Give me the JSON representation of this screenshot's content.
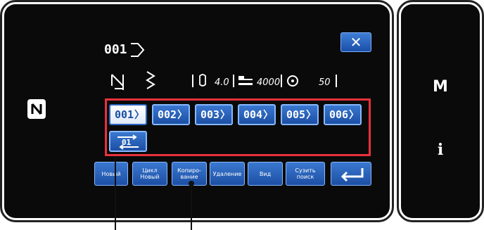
{
  "header": {
    "pattern_number": "001",
    "close_label": "✕"
  },
  "params": [
    {
      "icon": "thread-tension-icon",
      "value": "4.0"
    },
    {
      "icon": "sewing-speed-icon",
      "value": "4000"
    },
    {
      "icon": "presser-foot-icon",
      "value": "50"
    }
  ],
  "patterns": [
    {
      "label": "001",
      "selected": true
    },
    {
      "label": "002",
      "selected": false
    },
    {
      "label": "003",
      "selected": false
    },
    {
      "label": "004",
      "selected": false
    },
    {
      "label": "005",
      "selected": false
    },
    {
      "label": "006",
      "selected": false
    }
  ],
  "cycle_pattern": {
    "label": "01"
  },
  "toolbar": {
    "new": "Новый",
    "new_cycle": "Цикл\nНовый",
    "copy": "Копиро-\nвание",
    "delete": "Удаление",
    "view": "Вид",
    "filter": "Сузить\nпоиск"
  },
  "side": {
    "m": "M",
    "i": "i"
  },
  "colors": {
    "accent": "#2a66c2",
    "highlight": "#e8313b",
    "screen": "#000000"
  }
}
